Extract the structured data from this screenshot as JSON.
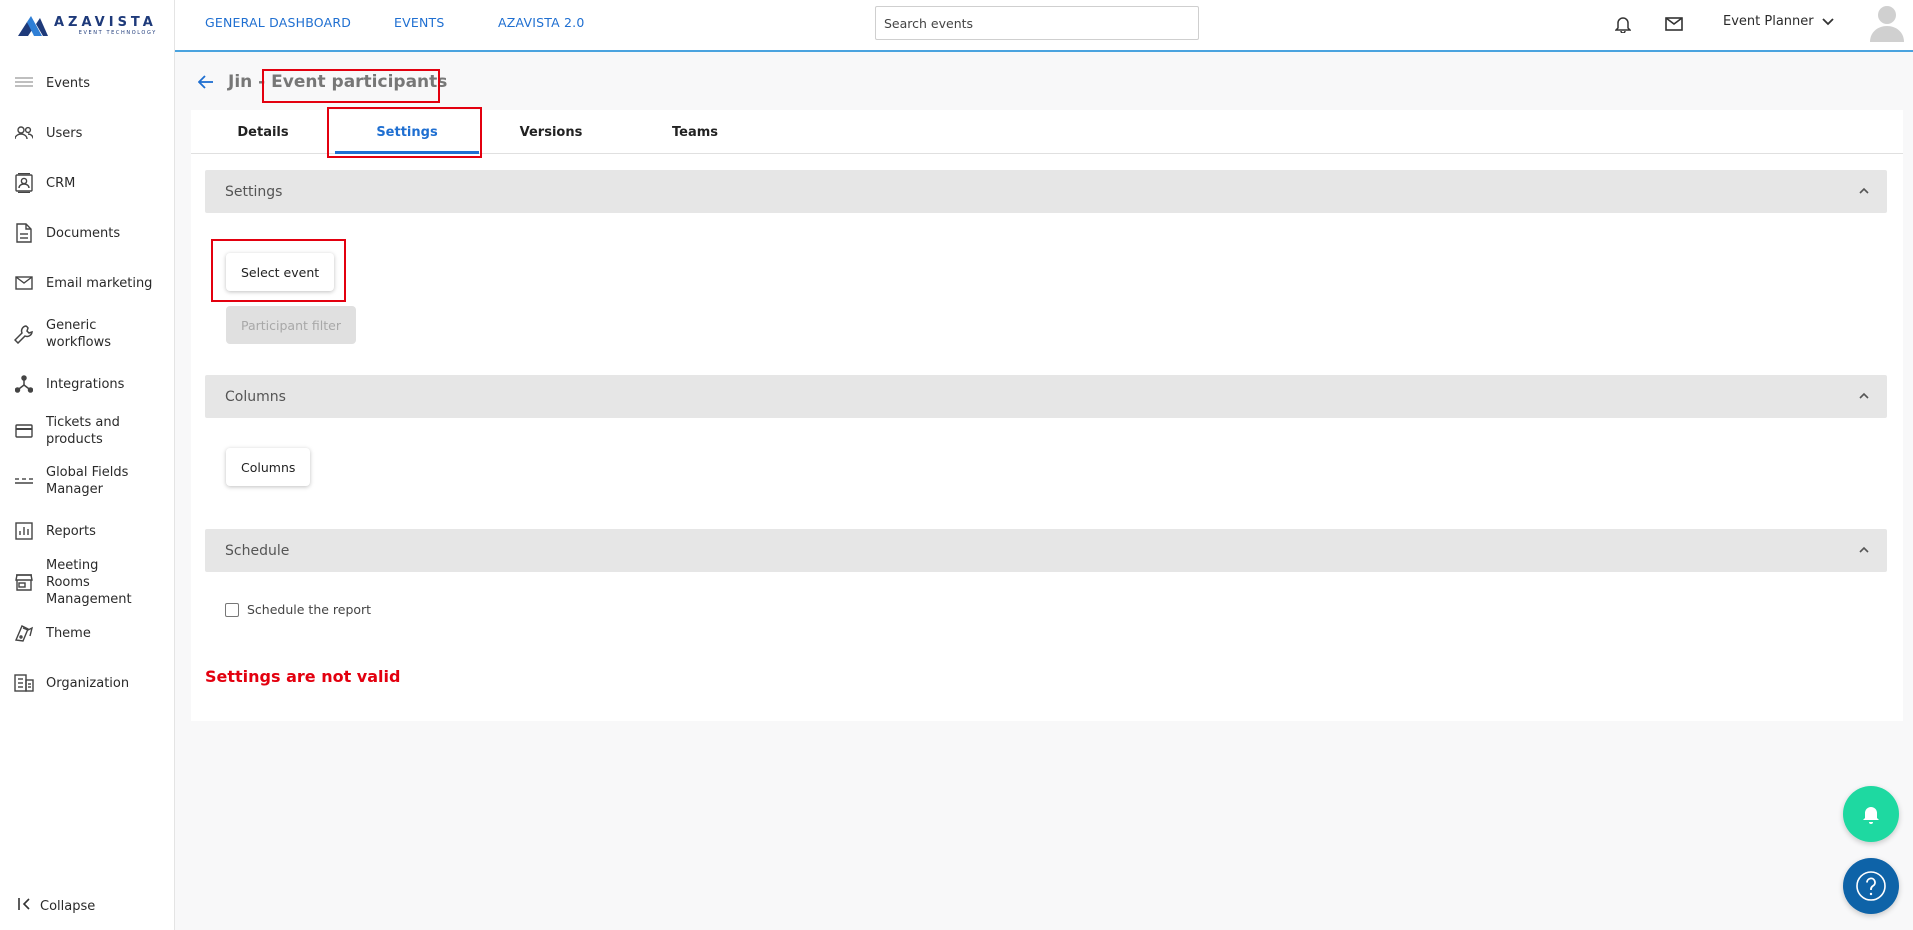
{
  "brand": {
    "name": "AZAVISTA",
    "tagline": "EVENT TECHNOLOGY",
    "color": "#1e3a7a"
  },
  "sidebar": {
    "items": [
      {
        "label": "Events",
        "icon": "list-icon"
      },
      {
        "label": "Users",
        "icon": "users-icon"
      },
      {
        "label": "CRM",
        "icon": "contact-card-icon"
      },
      {
        "label": "Documents",
        "icon": "document-icon"
      },
      {
        "label": "Email marketing",
        "icon": "envelope-icon"
      },
      {
        "label": "Generic workflows",
        "icon": "wrench-icon"
      },
      {
        "label": "Integrations",
        "icon": "network-icon"
      },
      {
        "label": "Tickets and products",
        "icon": "credit-card-icon"
      },
      {
        "label": "Global Fields Manager",
        "icon": "fields-icon"
      },
      {
        "label": "Reports",
        "icon": "bar-chart-icon"
      },
      {
        "label": "Meeting Rooms Management",
        "icon": "store-icon"
      },
      {
        "label": "Theme",
        "icon": "palette-icon"
      },
      {
        "label": "Organization",
        "icon": "building-icon"
      }
    ],
    "collapse_label": "Collapse"
  },
  "topbar": {
    "nav": [
      "GENERAL DASHBOARD",
      "EVENTS",
      "AZAVISTA 2.0"
    ],
    "search_placeholder": "Search events",
    "role": "Event Planner"
  },
  "page": {
    "title": "Jin - Event participants",
    "tabs": [
      "Details",
      "Settings",
      "Versions",
      "Teams"
    ],
    "active_tab": "Settings"
  },
  "sections": {
    "settings": {
      "title": "Settings",
      "select_event": "Select event",
      "participant_filter": "Participant filter"
    },
    "columns": {
      "title": "Columns",
      "button": "Columns"
    },
    "schedule": {
      "title": "Schedule",
      "checkbox_label": "Schedule the report",
      "checked": false
    }
  },
  "validation_message": "Settings are not valid",
  "colors": {
    "accent": "#1f6fd1",
    "error": "#e3000f",
    "notify_fab": "#1ed9a1",
    "help_fab": "#0e63a8"
  }
}
